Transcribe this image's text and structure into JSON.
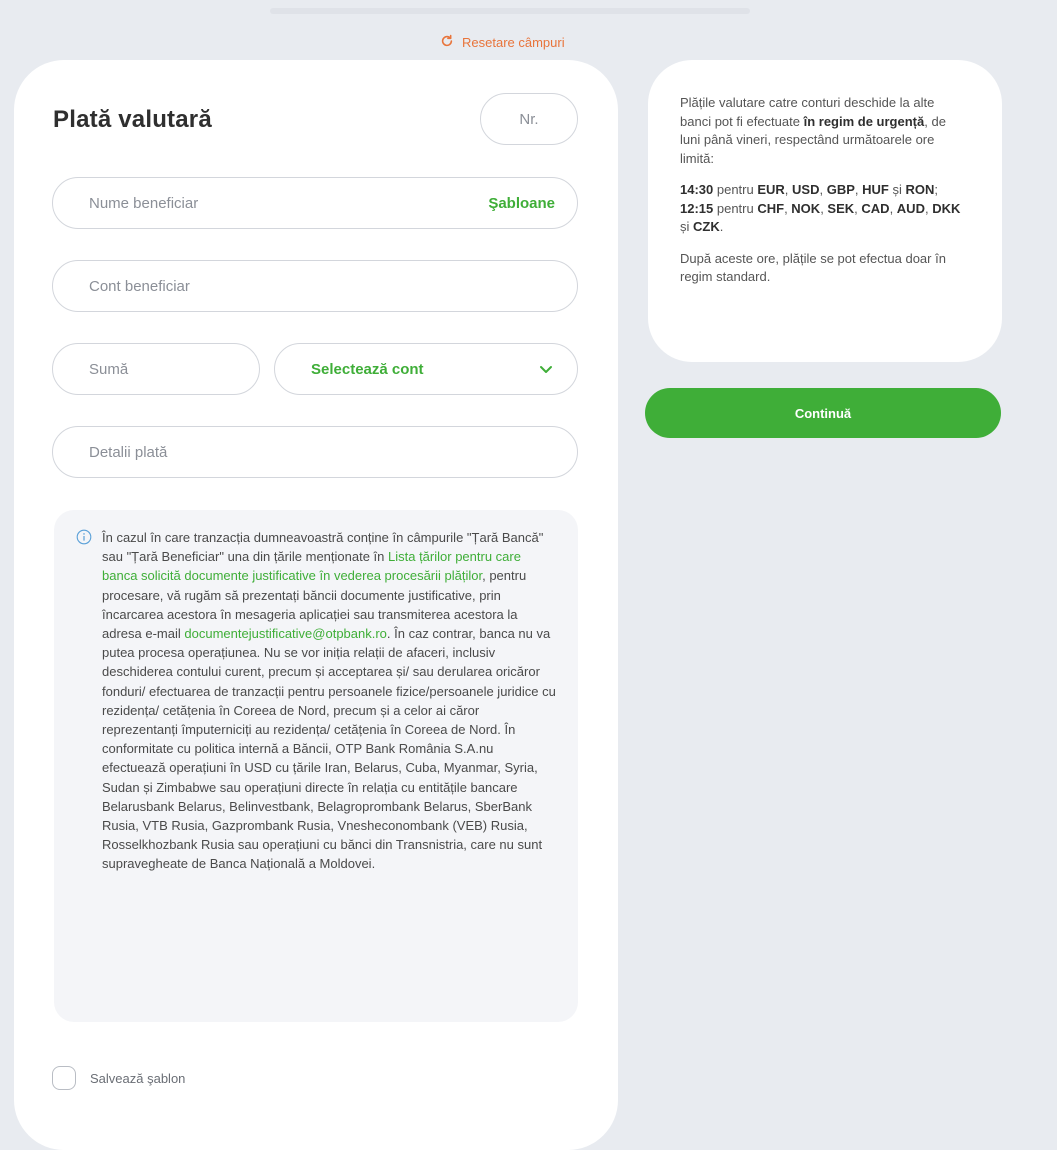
{
  "header": {
    "reset_label": "Resetare câmpuri"
  },
  "form": {
    "title": "Plată valutară",
    "nr_placeholder": "Nr.",
    "beneficiary_name_placeholder": "Nume beneficiar",
    "templates_label": "Şabloane",
    "beneficiary_account_placeholder": "Cont beneficiar",
    "amount_placeholder": "Sumă",
    "select_account_label": "Selectează cont",
    "payment_details_placeholder": "Detalii plată",
    "save_template_label": "Salvează şablon"
  },
  "notice": {
    "text_before_link": "În cazul în care tranzacția dumneavoastră conține în câmpurile \"Țară Bancă\" sau \"Țară Beneficiar\" una din țările menționate în ",
    "link_text": "Lista țărilor pentru care banca solicită documente justificative în vederea procesării plăților",
    "text_after_link": ", pentru procesare, vă rugăm să prezentați băncii documente justificative, prin încarcarea acestora în mesageria aplicației sau transmiterea acestora la adresa e-mail ",
    "email": "documentejustificative@otpbank.ro",
    "text_end": ". În caz contrar, banca nu va putea procesa operațiunea. Nu se vor iniția relații de afaceri, inclusiv deschiderea contului curent, precum și acceptarea și/ sau derularea oricăror fonduri/ efectuarea de tranzacții pentru persoanele fizice/persoanele juridice cu rezidența/ cetățenia în Coreea de Nord, precum și a celor ai căror reprezentanți împuterniciți au rezidența/ cetățenia în Coreea de Nord. În conformitate cu politica internă a Băncii, OTP Bank România S.A.nu efectuează operațiuni în USD cu țările Iran, Belarus, Cuba, Myanmar, Syria, Sudan și Zimbabwe sau operațiuni directe în relația cu entitățile bancare Belarusbank Belarus, Belinvestbank, Belagroprombank Belarus, SberBank Rusia, VTB Rusia, Gazprombank Rusia, Vnesheconombank (VEB) Rusia, Rosselkhozbank Rusia sau operațiuni cu bănci din Transnistria, care nu sunt supravegheate de Banca Națională a Moldovei."
  },
  "info_panel": {
    "p1_start": "Plățile valutare catre conturi deschide la alte banci pot fi efectuate ",
    "p1_bold": "în regim de urgență",
    "p1_end": ", de luni până vineri, respectând următoarele ore limită:",
    "time1": "14:30",
    "pentru1": " pentru ",
    "cur1_a": "EUR",
    "sep1": ", ",
    "cur1_b": "USD",
    "sep2": ", ",
    "cur1_c": "GBP",
    "sep3": ", ",
    "cur1_d": "HUF",
    "si1": " și ",
    "cur1_e": "RON",
    "end1": ";",
    "time2": "12:15",
    "pentru2": " pentru ",
    "cur2_a": "CHF",
    "sep4": ", ",
    "cur2_b": "NOK",
    "sep5": ", ",
    "cur2_c": "SEK",
    "sep6": ", ",
    "cur2_d": "CAD",
    "sep7": ", ",
    "cur2_e": "AUD",
    "sep8": ", ",
    "cur2_f": "DKK",
    "si2": " și ",
    "cur2_g": "CZK",
    "end2": ".",
    "p3": "După aceste ore, plățile se pot efectua doar în regim standard."
  },
  "actions": {
    "continue_label": "Continuă"
  },
  "colors": {
    "accent_green": "#3fae38",
    "reset_orange": "#e8743b",
    "background": "#e8ebf0"
  },
  "icons": {
    "reset": "refresh-icon",
    "select": "chevron-down-icon",
    "notice": "info-icon"
  }
}
